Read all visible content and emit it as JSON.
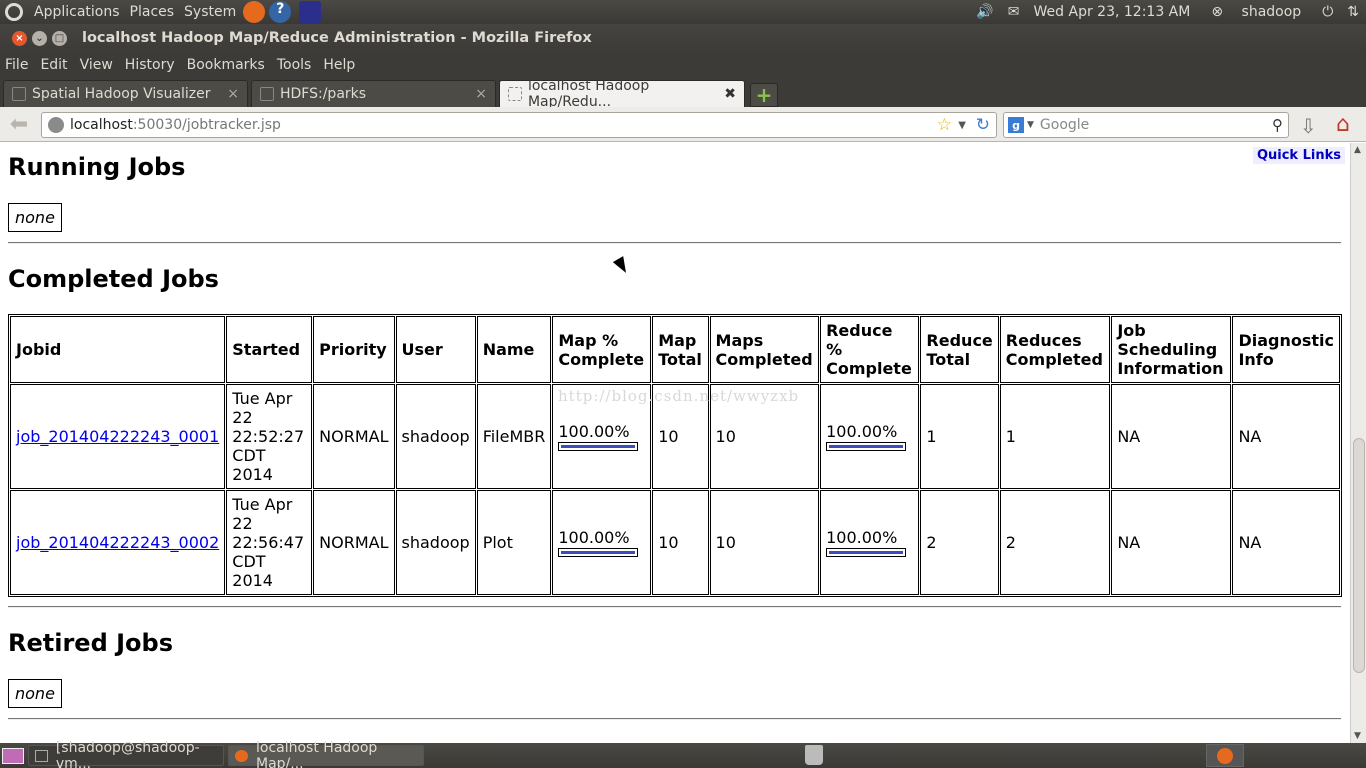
{
  "top_panel": {
    "menus": [
      "Applications",
      "Places",
      "System"
    ],
    "datetime": "Wed Apr 23, 12:13 AM",
    "user": "shadoop"
  },
  "window": {
    "title": "localhost Hadoop Map/Reduce Administration - Mozilla Firefox"
  },
  "menubar": [
    "File",
    "Edit",
    "View",
    "History",
    "Bookmarks",
    "Tools",
    "Help"
  ],
  "tabs": [
    {
      "label": "Spatial Hadoop Visualizer"
    },
    {
      "label": "HDFS:/parks"
    },
    {
      "label": "localhost Hadoop Map/Redu..."
    }
  ],
  "navbar": {
    "url_host": "localhost",
    "url_path": ":50030/jobtracker.jsp",
    "search_placeholder": "Google"
  },
  "page": {
    "quick_links": "Quick Links",
    "running_heading": "Running Jobs",
    "running_none": "none",
    "completed_heading": "Completed Jobs",
    "retired_heading": "Retired Jobs",
    "retired_none": "none",
    "watermark": "http://blog.csdn.net/wwyzxb",
    "columns": [
      "Jobid",
      "Started",
      "Priority",
      "User",
      "Name",
      "Map % Complete",
      "Map Total",
      "Maps Completed",
      "Reduce % Complete",
      "Reduce Total",
      "Reduces Completed",
      "Job Scheduling Information",
      "Diagnostic Info"
    ],
    "jobs": [
      {
        "jobid": "job_201404222243_0001",
        "started": "Tue Apr 22 22:52:27 CDT 2014",
        "priority": "NORMAL",
        "user": "shadoop",
        "name": "FileMBR",
        "map_pct": "100.00%",
        "map_pct_value": 1.0,
        "map_total": "10",
        "maps_completed": "10",
        "reduce_pct": "100.00%",
        "reduce_pct_value": 1.0,
        "reduce_total": "1",
        "reduces_completed": "1",
        "sched_info": "NA",
        "diag_info": "NA"
      },
      {
        "jobid": "job_201404222243_0002",
        "started": "Tue Apr 22 22:56:47 CDT 2014",
        "priority": "NORMAL",
        "user": "shadoop",
        "name": "Plot",
        "map_pct": "100.00%",
        "map_pct_value": 1.0,
        "map_total": "10",
        "maps_completed": "10",
        "reduce_pct": "100.00%",
        "reduce_pct_value": 1.0,
        "reduce_total": "2",
        "reduces_completed": "2",
        "sched_info": "NA",
        "diag_info": "NA"
      }
    ]
  },
  "taskbar": [
    {
      "label": "[shadoop@shadoop-vm..."
    },
    {
      "label": "localhost Hadoop Map/..."
    }
  ]
}
